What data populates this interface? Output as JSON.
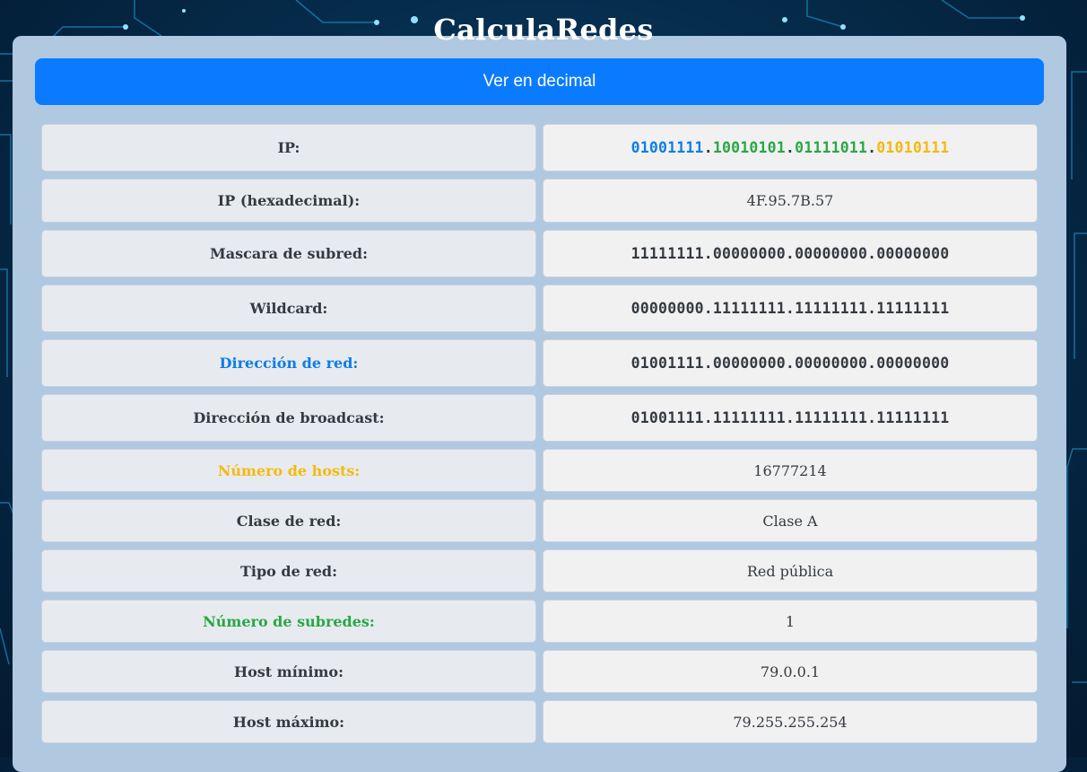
{
  "app": {
    "title": "CalculaRedes"
  },
  "toggle": {
    "label": "Ver en decimal"
  },
  "colors": {
    "blue": "#0e7de6",
    "green": "#29a745",
    "yellow": "#f5b90f",
    "button": "#0a7bff"
  },
  "rows": {
    "ip": {
      "label": "IP:",
      "oct1": "01001111",
      "oct2": "10010101",
      "oct3": "01111011",
      "oct4": "01010111",
      "dot": "."
    },
    "ip_hex": {
      "label": "IP (hexadecimal):",
      "value": "4F.95.7B.57"
    },
    "mask": {
      "label": "Mascara de subred:",
      "value": "11111111.00000000.00000000.00000000"
    },
    "wildcard": {
      "label": "Wildcard:",
      "value": "00000000.11111111.11111111.11111111"
    },
    "network": {
      "label": "Dirección de red:",
      "value": "01001111.00000000.00000000.00000000"
    },
    "broadcast": {
      "label": "Dirección de broadcast:",
      "value": "01001111.11111111.11111111.11111111"
    },
    "hosts": {
      "label": "Número de hosts:",
      "value": "16777214"
    },
    "class": {
      "label": "Clase de red:",
      "value": "Clase A"
    },
    "type": {
      "label": "Tipo de red:",
      "value": "Red pública"
    },
    "subnets": {
      "label": "Número de subredes:",
      "value": "1"
    },
    "host_min": {
      "label": "Host mínimo:",
      "value": "79.0.0.1"
    },
    "host_max": {
      "label": "Host máximo:",
      "value": "79.255.255.254"
    }
  }
}
